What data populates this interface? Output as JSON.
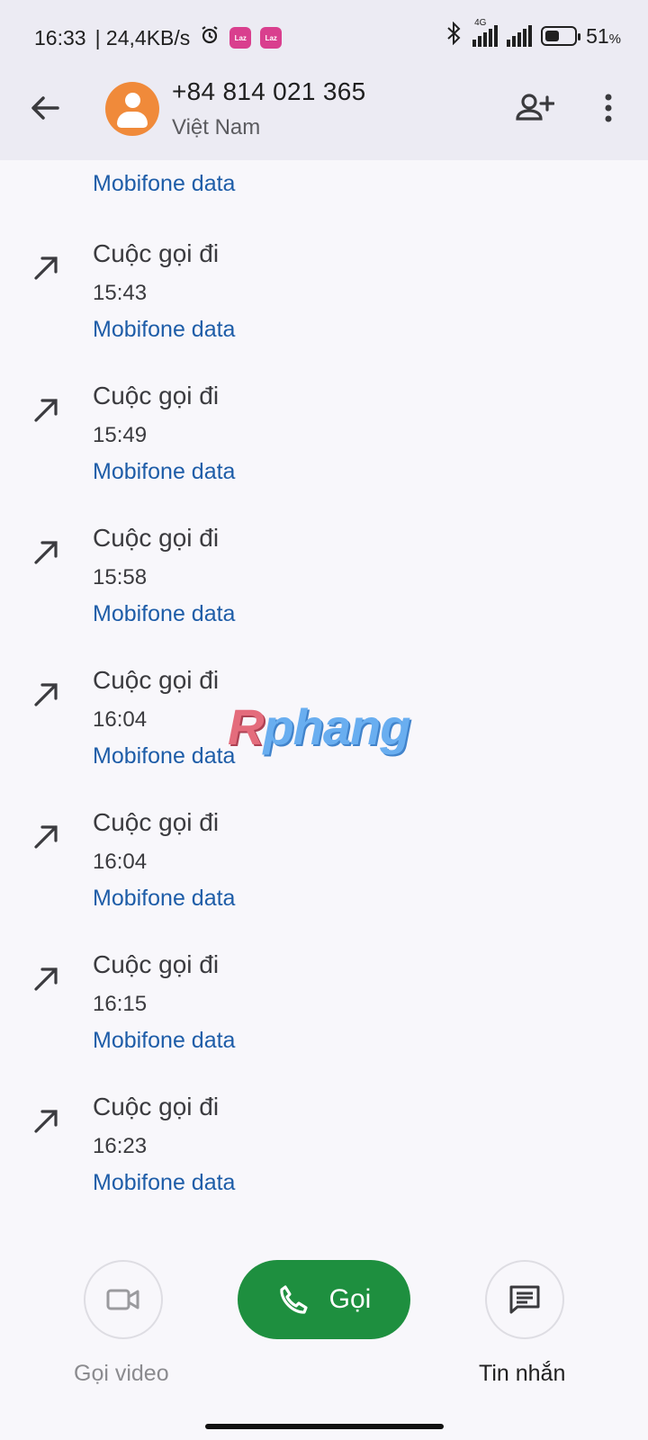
{
  "status_bar": {
    "time": "16:33",
    "speed": "| 24,4KB/s",
    "network_label": "4G",
    "battery_percent": "51",
    "battery_unit": "%",
    "battery_level": 0.51
  },
  "header": {
    "phone_number": "+84 814 021 365",
    "region": "Việt Nam"
  },
  "call_log": {
    "top_partial_network": "Mobifone data",
    "items": [
      {
        "type": "Cuộc gọi đi",
        "time": "15:43",
        "network": "Mobifone data"
      },
      {
        "type": "Cuộc gọi đi",
        "time": "15:49",
        "network": "Mobifone data"
      },
      {
        "type": "Cuộc gọi đi",
        "time": "15:58",
        "network": "Mobifone data"
      },
      {
        "type": "Cuộc gọi đi",
        "time": "16:04",
        "network": "Mobifone data"
      },
      {
        "type": "Cuộc gọi đi",
        "time": "16:04",
        "network": "Mobifone data"
      },
      {
        "type": "Cuộc gọi đi",
        "time": "16:15",
        "network": "Mobifone data"
      },
      {
        "type": "Cuộc gọi đi",
        "time": "16:23",
        "network": "Mobifone data"
      }
    ]
  },
  "watermark": {
    "first": "R",
    "rest": "phang"
  },
  "actions": {
    "video_label": "Gọi video",
    "call_label": "Gọi",
    "message_label": "Tin nhắn"
  },
  "colors": {
    "header_bg": "#ecebf3",
    "page_bg": "#f8f7fb",
    "link_blue": "#1e5da8",
    "call_green": "#1e8f3f",
    "avatar_orange": "#f08a3a"
  }
}
